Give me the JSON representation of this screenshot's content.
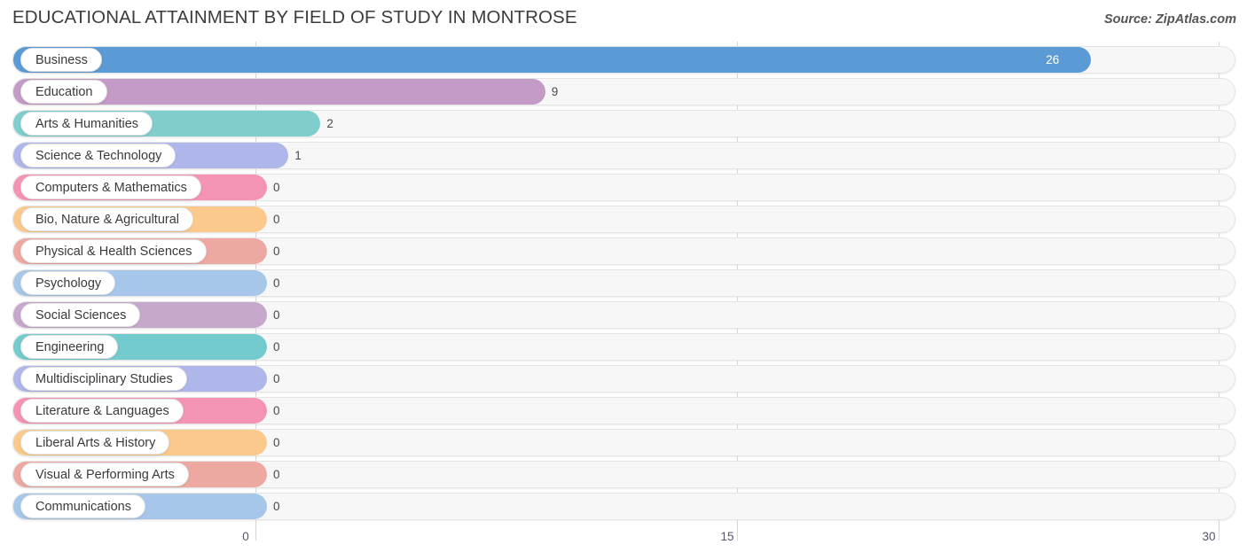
{
  "header": {
    "title": "EDUCATIONAL ATTAINMENT BY FIELD OF STUDY IN MONTROSE",
    "source": "Source: ZipAtlas.com"
  },
  "chart_data": {
    "type": "bar",
    "orientation": "horizontal",
    "title": "EDUCATIONAL ATTAINMENT BY FIELD OF STUDY IN MONTROSE",
    "subtitle": "",
    "xlabel": "",
    "ylabel": "",
    "xlim": [
      0,
      30
    ],
    "ticks": [
      "0",
      "15",
      "30"
    ],
    "tick_values": [
      0,
      15,
      30
    ],
    "grid": true,
    "legend": false,
    "categories": [
      "Business",
      "Education",
      "Arts & Humanities",
      "Science & Technology",
      "Computers & Mathematics",
      "Bio, Nature & Agricultural",
      "Physical & Health Sciences",
      "Psychology",
      "Social Sciences",
      "Engineering",
      "Multidisciplinary Studies",
      "Literature & Languages",
      "Liberal Arts & History",
      "Visual & Performing Arts",
      "Communications"
    ],
    "values": [
      26,
      9,
      2,
      1,
      0,
      0,
      0,
      0,
      0,
      0,
      0,
      0,
      0,
      0,
      0
    ],
    "value_labels": [
      "26",
      "9",
      "2",
      "1",
      "0",
      "0",
      "0",
      "0",
      "0",
      "0",
      "0",
      "0",
      "0",
      "0",
      "0"
    ],
    "colors": [
      "#5b9bd5",
      "#c39bc6",
      "#7fcdcd",
      "#aeb6ea",
      "#f593b4",
      "#fbc98b",
      "#eda8a1",
      "#a6c7ea",
      "#c7a8cd",
      "#74cbcd",
      "#aeb6ea",
      "#f593b4",
      "#fbc98b",
      "#eda8a1",
      "#a6c7ea"
    ]
  },
  "style": {
    "track_fill": "#f7f7f7",
    "track_border": "#e4e4e4",
    "grid_color": "#d8d8d8",
    "text_color": "#3a3a3a",
    "tick_color": "#55556a"
  }
}
